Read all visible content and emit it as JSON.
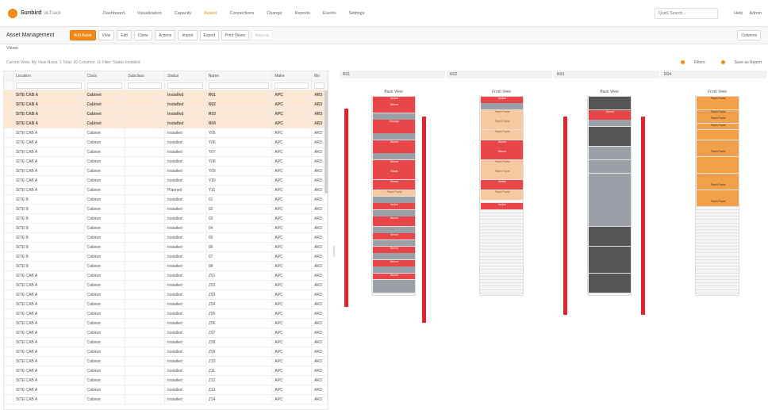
{
  "app": {
    "name": "Sunbird",
    "sub": "dcTrack"
  },
  "nav": {
    "items": [
      "Dashboard",
      "Visualization",
      "Capacity",
      "Assets",
      "Connections",
      "Change",
      "Reports",
      "Events",
      "Settings"
    ],
    "active_index": 3,
    "search_placeholder": "Quick Search...",
    "right_items": [
      "Help",
      "Admin"
    ]
  },
  "toolbar": {
    "title": "Asset Management",
    "buttons": [
      "Add Asset",
      "View",
      "Edit",
      "Clone",
      "Actions",
      "Import",
      "Export",
      "Print Views",
      "Reports"
    ],
    "right": "Columns"
  },
  "filter": {
    "label": "Views"
  },
  "summary": {
    "text": "Current View: My View  Rows: 1  Total: 26  Columns: 11  Filter: Status Installed",
    "right": [
      "Filters",
      "Save as Report"
    ]
  },
  "grid": {
    "columns": [
      "Location",
      "Class",
      "Subclass",
      "Status",
      "Name",
      "Make",
      "Mo"
    ],
    "rows": [
      {
        "loc": "SITE CAB A",
        "cls": "Cabinet",
        "sub": "",
        "status": "Installed",
        "name": "R01",
        "make": "APC",
        "mo": "AR3",
        "sel": true
      },
      {
        "loc": "SITE CAB A",
        "cls": "Cabinet",
        "sub": "",
        "status": "Installed",
        "name": "R02",
        "make": "APC",
        "mo": "AR3",
        "sel": true
      },
      {
        "loc": "SITE CAB A",
        "cls": "Cabinet",
        "sub": "",
        "status": "Installed",
        "name": "R03",
        "make": "APC",
        "mo": "AR3",
        "sel": true
      },
      {
        "loc": "SITE CAB A",
        "cls": "Cabinet",
        "sub": "",
        "status": "Installed",
        "name": "R04",
        "make": "APC",
        "mo": "AR3",
        "sel": true
      },
      {
        "loc": "SITE CAB A",
        "cls": "Cabinet",
        "sub": "",
        "status": "Installed",
        "name": "Y05",
        "make": "APC",
        "mo": "AR3",
        "sel": false
      },
      {
        "loc": "SITE CAB A",
        "cls": "Cabinet",
        "sub": "",
        "status": "Installed",
        "name": "Y06",
        "make": "APC",
        "mo": "AR3",
        "sel": false
      },
      {
        "loc": "SITE CAB A",
        "cls": "Cabinet",
        "sub": "",
        "status": "Installed",
        "name": "Y07",
        "make": "APC",
        "mo": "AR3",
        "sel": false
      },
      {
        "loc": "SITE CAB A",
        "cls": "Cabinet",
        "sub": "",
        "status": "Installed",
        "name": "Y08",
        "make": "APC",
        "mo": "AR3",
        "sel": false
      },
      {
        "loc": "SITE CAB A",
        "cls": "Cabinet",
        "sub": "",
        "status": "Installed",
        "name": "Y09",
        "make": "APC",
        "mo": "AR3",
        "sel": false
      },
      {
        "loc": "SITE CAB A",
        "cls": "Cabinet",
        "sub": "",
        "status": "Installed",
        "name": "Y10",
        "make": "APC",
        "mo": "AR3",
        "sel": false
      },
      {
        "loc": "SITE CAB A",
        "cls": "Cabinet",
        "sub": "",
        "status": "Planned",
        "name": "Y11",
        "make": "APC",
        "mo": "AR3",
        "sel": false
      },
      {
        "loc": "SITE B",
        "cls": "Cabinet",
        "sub": "",
        "status": "Installed",
        "name": "01",
        "make": "APC",
        "mo": "AR3",
        "sel": false
      },
      {
        "loc": "SITE B",
        "cls": "Cabinet",
        "sub": "",
        "status": "Installed",
        "name": "02",
        "make": "APC",
        "mo": "AR3",
        "sel": false
      },
      {
        "loc": "SITE B",
        "cls": "Cabinet",
        "sub": "",
        "status": "Installed",
        "name": "03",
        "make": "APC",
        "mo": "AR3",
        "sel": false
      },
      {
        "loc": "SITE B",
        "cls": "Cabinet",
        "sub": "",
        "status": "Installed",
        "name": "04",
        "make": "APC",
        "mo": "AR3",
        "sel": false
      },
      {
        "loc": "SITE B",
        "cls": "Cabinet",
        "sub": "",
        "status": "Installed",
        "name": "05",
        "make": "APC",
        "mo": "AR3",
        "sel": false
      },
      {
        "loc": "SITE B",
        "cls": "Cabinet",
        "sub": "",
        "status": "Installed",
        "name": "06",
        "make": "APC",
        "mo": "AR3",
        "sel": false
      },
      {
        "loc": "SITE B",
        "cls": "Cabinet",
        "sub": "",
        "status": "Installed",
        "name": "07",
        "make": "APC",
        "mo": "AR3",
        "sel": false
      },
      {
        "loc": "SITE B",
        "cls": "Cabinet",
        "sub": "",
        "status": "Installed",
        "name": "08",
        "make": "APC",
        "mo": "AR3",
        "sel": false
      },
      {
        "loc": "SITE CAB A",
        "cls": "Cabinet",
        "sub": "",
        "status": "Installed",
        "name": "Z01",
        "make": "APC",
        "mo": "AR3",
        "sel": false
      },
      {
        "loc": "SITE CAB A",
        "cls": "Cabinet",
        "sub": "",
        "status": "Installed",
        "name": "Z02",
        "make": "APC",
        "mo": "AR3",
        "sel": false
      },
      {
        "loc": "SITE CAB A",
        "cls": "Cabinet",
        "sub": "",
        "status": "Installed",
        "name": "Z03",
        "make": "APC",
        "mo": "AR3",
        "sel": false
      },
      {
        "loc": "SITE CAB A",
        "cls": "Cabinet",
        "sub": "",
        "status": "Installed",
        "name": "Z04",
        "make": "APC",
        "mo": "AR3",
        "sel": false
      },
      {
        "loc": "SITE CAB A",
        "cls": "Cabinet",
        "sub": "",
        "status": "Installed",
        "name": "Z05",
        "make": "APC",
        "mo": "AR3",
        "sel": false
      },
      {
        "loc": "SITE CAB A",
        "cls": "Cabinet",
        "sub": "",
        "status": "Installed",
        "name": "Z06",
        "make": "APC",
        "mo": "AR3",
        "sel": false
      },
      {
        "loc": "SITE CAB A",
        "cls": "Cabinet",
        "sub": "",
        "status": "Installed",
        "name": "Z07",
        "make": "APC",
        "mo": "AR3",
        "sel": false
      },
      {
        "loc": "SITE CAB A",
        "cls": "Cabinet",
        "sub": "",
        "status": "Installed",
        "name": "Z08",
        "make": "APC",
        "mo": "AR3",
        "sel": false
      },
      {
        "loc": "SITE CAB A",
        "cls": "Cabinet",
        "sub": "",
        "status": "Installed",
        "name": "Z09",
        "make": "APC",
        "mo": "AR3",
        "sel": false
      },
      {
        "loc": "SITE CAB A",
        "cls": "Cabinet",
        "sub": "",
        "status": "Installed",
        "name": "Z10",
        "make": "APC",
        "mo": "AR3",
        "sel": false
      },
      {
        "loc": "SITE CAB A",
        "cls": "Cabinet",
        "sub": "",
        "status": "Installed",
        "name": "Z11",
        "make": "APC",
        "mo": "AR3",
        "sel": false
      },
      {
        "loc": "SITE CAB A",
        "cls": "Cabinet",
        "sub": "",
        "status": "Installed",
        "name": "Z12",
        "make": "APC",
        "mo": "AR3",
        "sel": false
      },
      {
        "loc": "SITE CAB A",
        "cls": "Cabinet",
        "sub": "",
        "status": "Installed",
        "name": "Z13",
        "make": "APC",
        "mo": "AR3",
        "sel": false
      },
      {
        "loc": "SITE CAB A",
        "cls": "Cabinet",
        "sub": "",
        "status": "Installed",
        "name": "Z14",
        "make": "APC",
        "mo": "AR3",
        "sel": false
      }
    ]
  },
  "racks": [
    {
      "label": "R01",
      "view": "Back View",
      "devices": [
        {
          "start": 1,
          "size": 2,
          "kind": "red",
          "text": "Switch"
        },
        {
          "start": 3,
          "size": 3,
          "kind": "red",
          "text": "Server"
        },
        {
          "start": 6,
          "size": 2,
          "kind": "grey",
          "text": ""
        },
        {
          "start": 8,
          "size": 4,
          "kind": "red",
          "text": "Storage"
        },
        {
          "start": 12,
          "size": 2,
          "kind": "grey",
          "text": ""
        },
        {
          "start": 14,
          "size": 4,
          "kind": "red",
          "text": "Server"
        },
        {
          "start": 18,
          "size": 2,
          "kind": "grey",
          "text": ""
        },
        {
          "start": 20,
          "size": 3,
          "kind": "red",
          "text": "Server"
        },
        {
          "start": 23,
          "size": 3,
          "kind": "red",
          "text": "Blade"
        },
        {
          "start": 26,
          "size": 3,
          "kind": "red",
          "text": "Server"
        },
        {
          "start": 29,
          "size": 2,
          "kind": "peach",
          "text": "Patch Panel"
        },
        {
          "start": 31,
          "size": 2,
          "kind": "grey",
          "text": ""
        },
        {
          "start": 33,
          "size": 2,
          "kind": "red",
          "text": "Switch"
        },
        {
          "start": 35,
          "size": 2,
          "kind": "grey",
          "text": ""
        },
        {
          "start": 37,
          "size": 3,
          "kind": "red",
          "text": "Server"
        },
        {
          "start": 40,
          "size": 2,
          "kind": "grey",
          "text": ""
        },
        {
          "start": 42,
          "size": 2,
          "kind": "red",
          "text": "Server"
        },
        {
          "start": 44,
          "size": 2,
          "kind": "grey",
          "text": ""
        },
        {
          "start": 46,
          "size": 2,
          "kind": "red",
          "text": "Server"
        },
        {
          "start": 48,
          "size": 2,
          "kind": "grey",
          "text": ""
        },
        {
          "start": 50,
          "size": 2,
          "kind": "red",
          "text": "Server"
        },
        {
          "start": 52,
          "size": 2,
          "kind": "grey",
          "text": ""
        },
        {
          "start": 54,
          "size": 2,
          "kind": "red",
          "text": "Server"
        },
        {
          "start": 56,
          "size": 4,
          "kind": "grey",
          "text": ""
        }
      ]
    },
    {
      "label": "R02",
      "view": "Front View",
      "devices": [
        {
          "start": 1,
          "size": 2,
          "kind": "red",
          "text": "Switch"
        },
        {
          "start": 3,
          "size": 2,
          "kind": "grey",
          "text": ""
        },
        {
          "start": 5,
          "size": 3,
          "kind": "peach",
          "text": "Patch Panel"
        },
        {
          "start": 8,
          "size": 3,
          "kind": "peach",
          "text": "Patch Panel"
        },
        {
          "start": 11,
          "size": 3,
          "kind": "peach",
          "text": "Patch Panel"
        },
        {
          "start": 14,
          "size": 3,
          "kind": "red",
          "text": "Server"
        },
        {
          "start": 17,
          "size": 3,
          "kind": "red",
          "text": "Server"
        },
        {
          "start": 20,
          "size": 3,
          "kind": "peach",
          "text": "Patch Panel"
        },
        {
          "start": 23,
          "size": 3,
          "kind": "peach",
          "text": "Patch Panel"
        },
        {
          "start": 26,
          "size": 3,
          "kind": "red",
          "text": "Switch"
        },
        {
          "start": 29,
          "size": 3,
          "kind": "peach",
          "text": "Patch Panel"
        },
        {
          "start": 33,
          "size": 2,
          "kind": "red",
          "text": "Switch"
        }
      ]
    },
    {
      "label": "R03",
      "view": "Back View",
      "devices": [
        {
          "start": 1,
          "size": 4,
          "kind": "dark",
          "text": ""
        },
        {
          "start": 5,
          "size": 3,
          "kind": "red",
          "text": "Server"
        },
        {
          "start": 8,
          "size": 2,
          "kind": "grey",
          "text": ""
        },
        {
          "start": 10,
          "size": 2,
          "kind": "dark",
          "text": ""
        },
        {
          "start": 12,
          "size": 4,
          "kind": "dark",
          "text": ""
        },
        {
          "start": 16,
          "size": 4,
          "kind": "grey",
          "text": ""
        },
        {
          "start": 20,
          "size": 4,
          "kind": "grey",
          "text": ""
        },
        {
          "start": 24,
          "size": 16,
          "kind": "grey",
          "text": ""
        },
        {
          "start": 40,
          "size": 6,
          "kind": "dark",
          "text": ""
        },
        {
          "start": 46,
          "size": 8,
          "kind": "dark",
          "text": ""
        },
        {
          "start": 54,
          "size": 6,
          "kind": "dark",
          "text": ""
        }
      ]
    },
    {
      "label": "R04",
      "view": "Front View",
      "devices": [
        {
          "start": 1,
          "size": 2,
          "kind": "orange",
          "text": "Patch Panel"
        },
        {
          "start": 3,
          "size": 2,
          "kind": "orange",
          "text": ""
        },
        {
          "start": 5,
          "size": 2,
          "kind": "orange",
          "text": "Patch Panel"
        },
        {
          "start": 7,
          "size": 2,
          "kind": "orange",
          "text": "Patch Panel"
        },
        {
          "start": 9,
          "size": 2,
          "kind": "orange",
          "text": "Patch Panel"
        },
        {
          "start": 11,
          "size": 3,
          "kind": "orange",
          "text": ""
        },
        {
          "start": 14,
          "size": 3,
          "kind": "orange",
          "text": ""
        },
        {
          "start": 17,
          "size": 2,
          "kind": "orange",
          "text": "Patch Panel"
        },
        {
          "start": 19,
          "size": 3,
          "kind": "orange",
          "text": ""
        },
        {
          "start": 22,
          "size": 2,
          "kind": "orange",
          "text": ""
        },
        {
          "start": 24,
          "size": 3,
          "kind": "orange",
          "text": ""
        },
        {
          "start": 27,
          "size": 2,
          "kind": "orange",
          "text": "Patch Panel"
        },
        {
          "start": 29,
          "size": 3,
          "kind": "orange",
          "text": ""
        },
        {
          "start": 32,
          "size": 2,
          "kind": "orange",
          "text": "Patch Panel"
        }
      ]
    }
  ],
  "colors": {
    "accent": "#f28a17",
    "selected_row": "#fce7d2",
    "pdu": "#e2242a"
  }
}
